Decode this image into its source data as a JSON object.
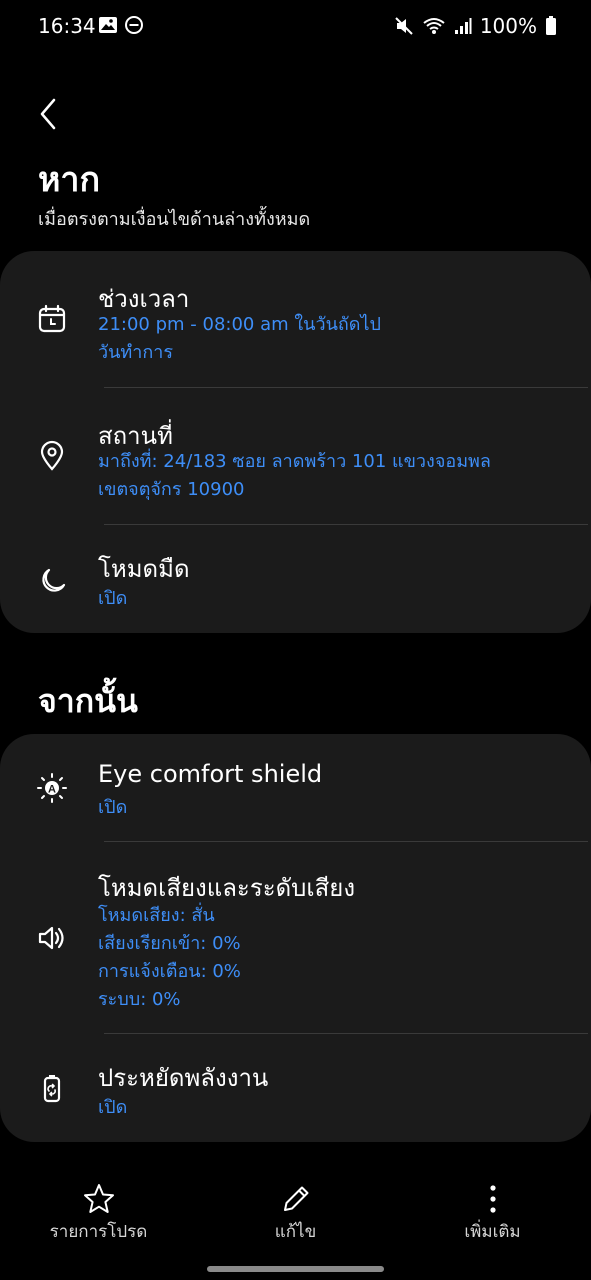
{
  "status_bar": {
    "time": "16:34",
    "battery": "100%"
  },
  "header": {
    "title": "หาก",
    "subtitle": "เมื่อตรงตามเงื่อนไขด้านล่างทั้งหมด"
  },
  "conditions": [
    {
      "title": "ช่วงเวลา",
      "lines": [
        "21:00 pm - 08:00 am ในวันถัดไป",
        "วันทำการ"
      ],
      "icon": "calendar-icon"
    },
    {
      "title": "สถานที่",
      "lines": [
        "มาถึงที่: 24/183 ซอย ลาดพร้าว 101 แขวงจอมพล",
        "เขตจตุจักร  10900"
      ],
      "icon": "location-pin-icon"
    },
    {
      "title": "โหมดมืด",
      "lines": [
        "เปิด"
      ],
      "icon": "moon-icon"
    }
  ],
  "then_section": {
    "title": "จากนั้น"
  },
  "actions": [
    {
      "title": "Eye comfort shield",
      "lines": [
        "เปิด"
      ],
      "icon": "eye-comfort-icon"
    },
    {
      "title": "โหมดเสียงและระดับเสียง",
      "lines": [
        "โหมดเสียง: สั่น",
        "เสียงเรียกเข้า: 0%",
        "การแจ้งเตือน: 0%",
        "ระบบ: 0%"
      ],
      "icon": "speaker-icon"
    },
    {
      "title": "ประหยัดพลังงาน",
      "lines": [
        "เปิด"
      ],
      "icon": "battery-saver-icon"
    }
  ],
  "bottom_nav": {
    "favorite_label": "รายการโปรด",
    "edit_label": "แก้ไข",
    "more_label": "เพิ่มเติม"
  },
  "colors": {
    "accent": "#3e8ef7",
    "card": "#1b1b1b",
    "background": "#000000"
  }
}
